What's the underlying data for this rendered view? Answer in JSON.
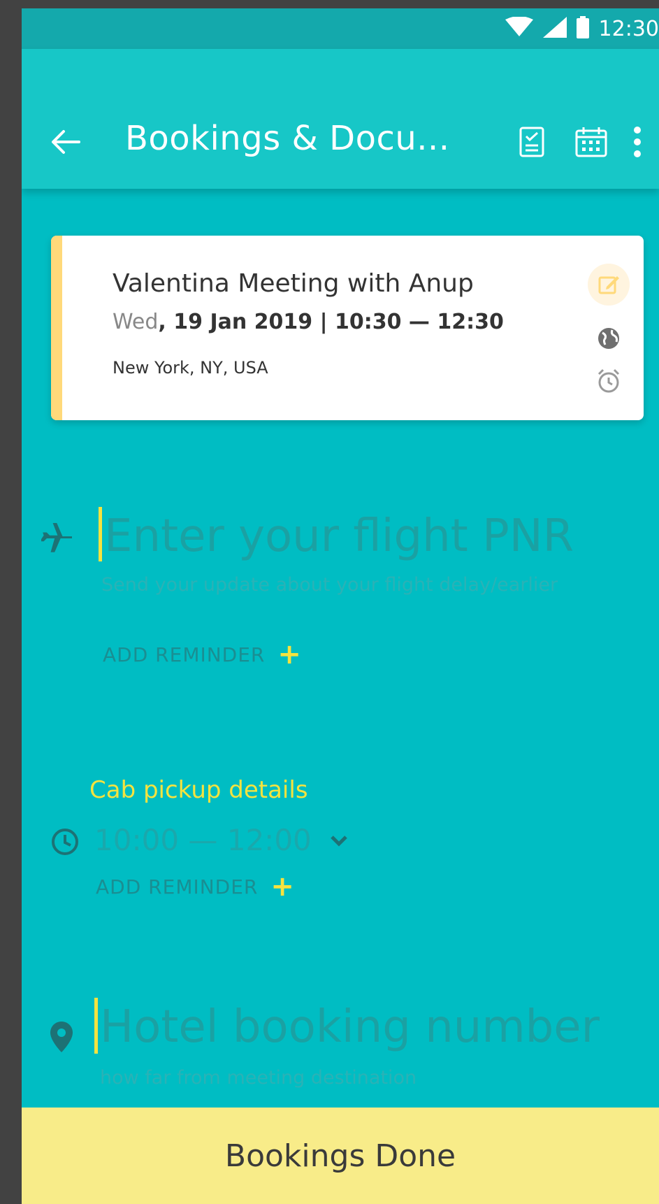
{
  "status_bar": {
    "time": "12:30"
  },
  "app_bar": {
    "title": "Bookings & Docu...",
    "back_icon": "arrow-left-icon",
    "actions": [
      "checklist-icon",
      "calendar-icon",
      "more-vert-icon"
    ]
  },
  "meeting_card": {
    "title": "Valentina Meeting with Anup",
    "day": "Wed",
    "date_rest": ", 19 Jan 2019 | 10:30  — 12:30",
    "location": "New York, NY, USA",
    "accent_color": "#ffd97a",
    "icons": [
      "edit-icon",
      "globe-icon",
      "alarm-clock-icon"
    ]
  },
  "flight": {
    "icon": "airplane-icon",
    "placeholder": "Enter your flight PNR",
    "hint": "Send your update about your flight delay/earlier",
    "reminder_label": "ADD REMINDER",
    "reminder_plus": "+"
  },
  "cab": {
    "label": "Cab pickup details",
    "icon": "clock-icon",
    "time_range": "10:00 — 12:00",
    "reminder_label": "ADD REMINDER",
    "reminder_plus": "+"
  },
  "hotel": {
    "icon": "location-pin-icon",
    "placeholder": "Hotel booking number",
    "hint": "how far from meeting destination"
  },
  "footer": {
    "button_label": "Bookings Done"
  },
  "colors": {
    "background": "#00bdc3",
    "app_bar": "#17c7c7",
    "accent_yellow": "#f5e33f",
    "footer": "#f8ec89"
  }
}
